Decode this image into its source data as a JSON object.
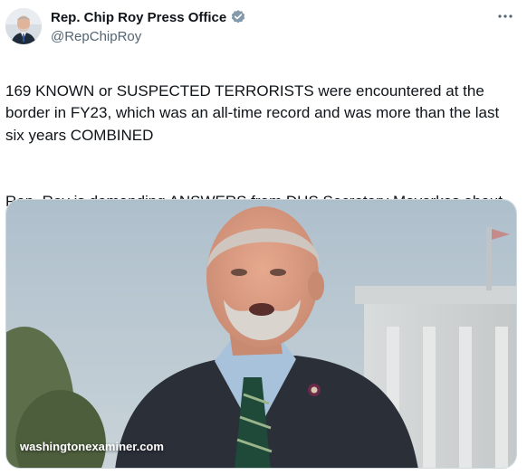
{
  "author": {
    "display_name": "Rep. Chip Roy Press Office",
    "handle": "@RepChipRoy",
    "verified_icon": "verified-badge-icon",
    "verified_color": "#829aab"
  },
  "more_icon": "more-options-icon",
  "tweet": {
    "paragraph_1": "169 KNOWN or SUSPECTED TERRORISTS were encountered at the border in FY23, which was an all-time record and was more than the last six years COMBINED",
    "paragraph_2": "Rep. Roy is demanding ANSWERS from DHS Secretary Mayorkas about who exactly is entering our country",
    "emoji_icon": "right-arrow-curving-down-icon",
    "emoji_color": "#3b88c3"
  },
  "media": {
    "source_label": "washingtonexaminer.com"
  }
}
